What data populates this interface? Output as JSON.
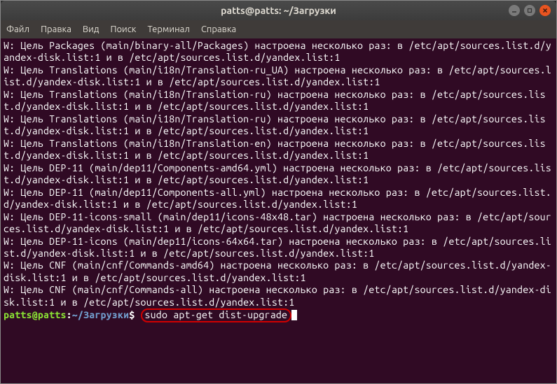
{
  "window": {
    "title": "patts@patts: ~/Загрузки"
  },
  "menu": {
    "file": "Файл",
    "edit": "Правка",
    "view": "Вид",
    "search": "Поиск",
    "terminal": "Терминал",
    "help": "Справка"
  },
  "terminal": {
    "lines": [
      "W: Цель Packages (main/binary-all/Packages) настроена несколько раз: в /etc/apt/sources.list.d/yandex-disk.list:1 и в /etc/apt/sources.list.d/yandex.list:1",
      "W: Цель Translations (main/i18n/Translation-ru_UA) настроена несколько раз: в /etc/apt/sources.list.d/yandex-disk.list:1 и в /etc/apt/sources.list.d/yandex.list:1",
      "W: Цель Translations (main/i18n/Translation-ru) настроена несколько раз: в /etc/apt/sources.list.d/yandex-disk.list:1 и в /etc/apt/sources.list.d/yandex.list:1",
      "W: Цель Translations (main/i18n/Translation-ru) настроена несколько раз: в /etc/apt/sources.list.d/yandex-disk.list:1 и в /etc/apt/sources.list.d/yandex.list:1",
      "W: Цель Translations (main/i18n/Translation-en) настроена несколько раз: в /etc/apt/sources.list.d/yandex-disk.list:1 и в /etc/apt/sources.list.d/yandex.list:1",
      "W: Цель DEP-11 (main/dep11/Components-amd64.yml) настроена несколько раз: в /etc/apt/sources.list.d/yandex-disk.list:1 и в /etc/apt/sources.list.d/yandex.list:1",
      "W: Цель DEP-11 (main/dep11/Components-all.yml) настроена несколько раз: в /etc/apt/sources.list.d/yandex-disk.list:1 и в /etc/apt/sources.list.d/yandex.list:1",
      "W: Цель DEP-11-icons-small (main/dep11/icons-48x48.tar) настроена несколько раз: в /etc/apt/sources.list.d/yandex-disk.list:1 и в /etc/apt/sources.list.d/yandex.list:1",
      "W: Цель DEP-11-icons (main/dep11/icons-64x64.tar) настроена несколько раз: в /etc/apt/sources.list.d/yandex-disk.list:1 и в /etc/apt/sources.list.d/yandex.list:1",
      "W: Цель CNF (main/cnf/Commands-amd64) настроена несколько раз: в /etc/apt/sources.list.d/yandex-disk.list:1 и в /etc/apt/sources.list.d/yandex.list:1",
      "W: Цель CNF (main/cnf/Commands-all) настроена несколько раз: в /etc/apt/sources.list.d/yandex-disk.list:1 и в /etc/apt/sources.list.d/yandex.list:1"
    ],
    "prompt_user": "patts@patts",
    "prompt_colon1": ":",
    "prompt_path": "~/Загрузки",
    "prompt_dollar": "$ ",
    "command": "sudo apt-get dist-upgrade"
  }
}
